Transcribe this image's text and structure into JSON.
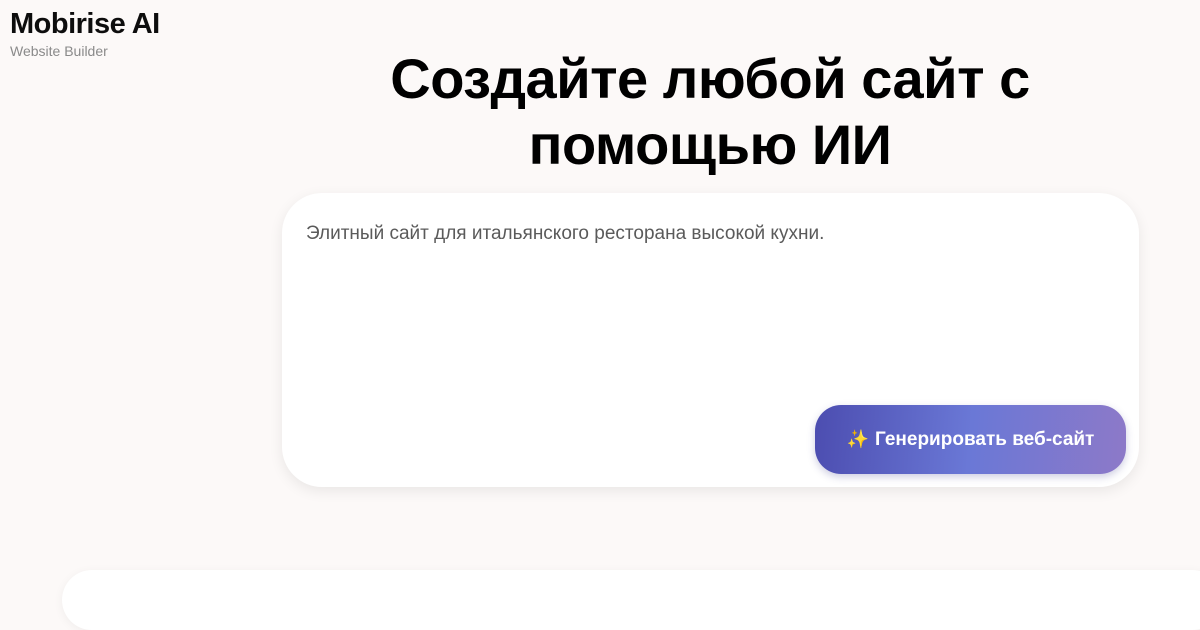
{
  "brand": {
    "title": "Mobirise AI",
    "subtitle": "Website Builder"
  },
  "hero": {
    "title": "Создайте любой сайт с помощью ИИ"
  },
  "prompt": {
    "text": "Элитный сайт для итальянского ресторана высокой кухни."
  },
  "generate_button": {
    "icon": "sparkles-icon",
    "icon_glyph": "✨",
    "label": "Генерировать веб-сайт"
  },
  "colors": {
    "background": "#fcf9f8",
    "button_gradient_start": "#4c4db0",
    "button_gradient_end": "#8d79c8"
  }
}
